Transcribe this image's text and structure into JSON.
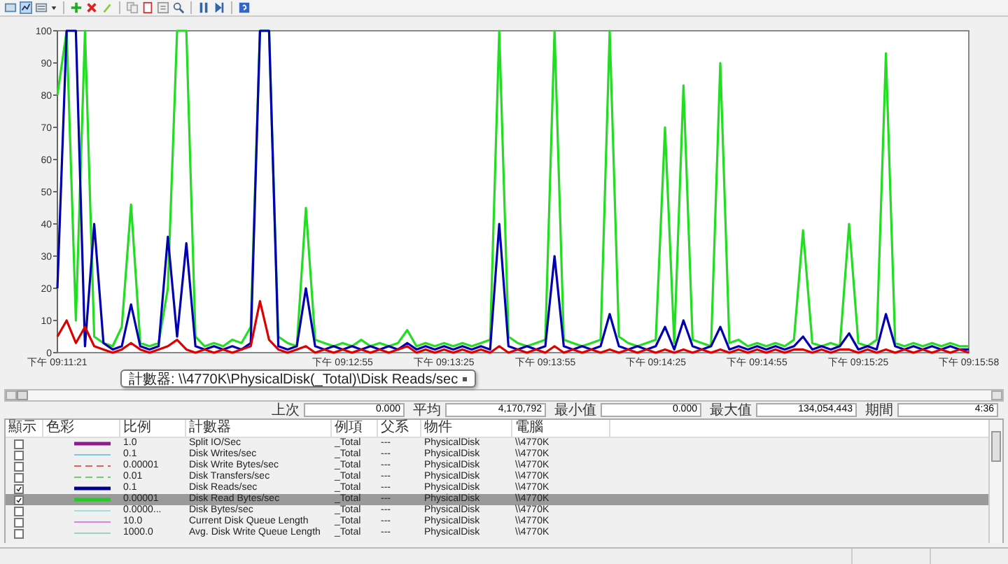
{
  "chart": {
    "tooltip": "計數器: \\\\4770K\\PhysicalDisk(_Total)\\Disk Reads/sec",
    "chart_data": {
      "type": "line",
      "ylim": [
        0,
        100
      ],
      "yticks": [
        0,
        10,
        20,
        30,
        40,
        50,
        60,
        70,
        80,
        90,
        100
      ],
      "categories": [
        "下午 09:11:21",
        null,
        null,
        null,
        null,
        null,
        null,
        null,
        null,
        null,
        null,
        null,
        null,
        null,
        null,
        null,
        null,
        null,
        null,
        null,
        null,
        null,
        null,
        null,
        null,
        null,
        null,
        null,
        null,
        null,
        null,
        "下午 09:12:55",
        null,
        null,
        null,
        null,
        null,
        null,
        null,
        null,
        null,
        null,
        "下午 09:13:25",
        null,
        null,
        null,
        null,
        null,
        null,
        null,
        null,
        null,
        null,
        "下午 09:13:55",
        null,
        null,
        null,
        null,
        null,
        null,
        null,
        null,
        null,
        null,
        null,
        "下午 09:14:25",
        null,
        null,
        null,
        null,
        null,
        null,
        null,
        null,
        null,
        null,
        "下午 09:14:55",
        null,
        null,
        null,
        null,
        null,
        null,
        null,
        null,
        null,
        null,
        "下午 09:15:25",
        null,
        null,
        null,
        null,
        null,
        null,
        null,
        null,
        null,
        null,
        null,
        "下午 09:15:58"
      ],
      "series": [
        {
          "color": "#22dd22",
          "values": [
            80,
            100,
            10,
            100,
            5,
            3,
            2,
            8,
            46,
            3,
            2,
            3,
            20,
            100,
            100,
            5,
            2,
            3,
            2,
            4,
            3,
            8,
            100,
            100,
            5,
            3,
            2,
            45,
            4,
            3,
            2,
            3,
            2,
            4,
            2,
            3,
            2,
            3,
            7,
            2,
            3,
            2,
            3,
            2,
            3,
            2,
            3,
            4,
            100,
            5,
            3,
            2,
            3,
            4,
            100,
            4,
            3,
            2,
            3,
            4,
            100,
            5,
            3,
            2,
            3,
            4,
            70,
            3,
            83,
            4,
            3,
            2,
            90,
            3,
            4,
            2,
            3,
            2,
            3,
            2,
            4,
            38,
            3,
            2,
            3,
            2,
            40,
            3,
            2,
            4,
            93,
            3,
            2,
            3,
            2,
            3,
            2,
            3,
            2,
            2
          ]
        },
        {
          "color": "#0000b0",
          "values": [
            20,
            100,
            100,
            2,
            40,
            3,
            1,
            2,
            15,
            2,
            1,
            2,
            36,
            5,
            34,
            2,
            1,
            2,
            1,
            2,
            1,
            3,
            100,
            100,
            2,
            1,
            2,
            20,
            2,
            1,
            2,
            1,
            2,
            1,
            2,
            1,
            2,
            1,
            3,
            1,
            2,
            1,
            2,
            1,
            2,
            1,
            2,
            1,
            40,
            2,
            1,
            2,
            1,
            2,
            30,
            2,
            1,
            2,
            1,
            2,
            12,
            2,
            1,
            2,
            1,
            2,
            8,
            1,
            10,
            2,
            1,
            2,
            8,
            1,
            2,
            1,
            2,
            1,
            2,
            1,
            2,
            5,
            1,
            2,
            1,
            2,
            6,
            1,
            2,
            1,
            12,
            2,
            1,
            2,
            1,
            2,
            1,
            2,
            1,
            1
          ]
        },
        {
          "color": "#dd0000",
          "values": [
            5,
            10,
            3,
            8,
            2,
            1,
            0,
            1,
            3,
            1,
            0,
            1,
            2,
            4,
            1,
            0,
            1,
            0,
            1,
            0,
            1,
            2,
            16,
            4,
            1,
            0,
            1,
            2,
            0,
            1,
            0,
            1,
            0,
            1,
            0,
            1,
            0,
            1,
            2,
            0,
            1,
            0,
            1,
            0,
            1,
            0,
            1,
            0,
            2,
            0,
            1,
            0,
            1,
            0,
            2,
            0,
            1,
            0,
            1,
            0,
            1,
            0,
            1,
            0,
            1,
            0,
            1,
            0,
            1,
            0,
            1,
            0,
            1,
            0,
            1,
            0,
            1,
            0,
            1,
            0,
            1,
            1,
            0,
            1,
            0,
            1,
            1,
            0,
            1,
            0,
            1,
            0,
            1,
            0,
            1,
            0,
            1,
            0,
            1,
            0
          ]
        }
      ]
    }
  },
  "stats": [
    {
      "label": "上次",
      "value": "0.000"
    },
    {
      "label": "平均",
      "value": "4,170,792"
    },
    {
      "label": "最小值",
      "value": "0.000"
    },
    {
      "label": "最大值",
      "value": "134,054,443"
    },
    {
      "label": "期間",
      "value": "4:36"
    }
  ],
  "table": {
    "columns": [
      "顯示",
      "色彩",
      "比例",
      "計數器",
      "例項",
      "父系",
      "物件",
      "電腦"
    ],
    "rows": [
      {
        "checked": false,
        "selected": false,
        "color": "#8b1a8b",
        "dashed": false,
        "thick": true,
        "scale": "1.0",
        "counter": "Split IO/Sec",
        "instance": "_Total",
        "parent": "---",
        "object": "PhysicalDisk",
        "computer": "\\\\4770K"
      },
      {
        "checked": false,
        "selected": false,
        "color": "#7fc8e0",
        "dashed": false,
        "thick": false,
        "scale": "0.1",
        "counter": "Disk Writes/sec",
        "instance": "_Total",
        "parent": "---",
        "object": "PhysicalDisk",
        "computer": "\\\\4770K"
      },
      {
        "checked": false,
        "selected": false,
        "color": "#e06060",
        "dashed": true,
        "thick": false,
        "scale": "0.00001",
        "counter": "Disk Write Bytes/sec",
        "instance": "_Total",
        "parent": "---",
        "object": "PhysicalDisk",
        "computer": "\\\\4770K"
      },
      {
        "checked": false,
        "selected": false,
        "color": "#70cc70",
        "dashed": true,
        "thick": false,
        "scale": "0.01",
        "counter": "Disk Transfers/sec",
        "instance": "_Total",
        "parent": "---",
        "object": "PhysicalDisk",
        "computer": "\\\\4770K"
      },
      {
        "checked": true,
        "selected": false,
        "color": "#00008b",
        "dashed": false,
        "thick": true,
        "scale": "0.1",
        "counter": "Disk Reads/sec",
        "instance": "_Total",
        "parent": "---",
        "object": "PhysicalDisk",
        "computer": "\\\\4770K"
      },
      {
        "checked": true,
        "selected": true,
        "color": "#22cc22",
        "dashed": false,
        "thick": true,
        "scale": "0.00001",
        "counter": "Disk Read Bytes/sec",
        "instance": "_Total",
        "parent": "---",
        "object": "PhysicalDisk",
        "computer": "\\\\4770K"
      },
      {
        "checked": false,
        "selected": false,
        "color": "#a0e0e0",
        "dashed": false,
        "thick": false,
        "scale": "0.0000...",
        "counter": "Disk Bytes/sec",
        "instance": "_Total",
        "parent": "---",
        "object": "PhysicalDisk",
        "computer": "\\\\4770K"
      },
      {
        "checked": false,
        "selected": false,
        "color": "#e080e0",
        "dashed": false,
        "thick": false,
        "scale": "10.0",
        "counter": "Current Disk Queue Length",
        "instance": "_Total",
        "parent": "---",
        "object": "PhysicalDisk",
        "computer": "\\\\4770K"
      },
      {
        "checked": false,
        "selected": false,
        "color": "#a0d0c0",
        "dashed": false,
        "thick": false,
        "scale": "1000.0",
        "counter": "Avg. Disk Write Queue Length",
        "instance": "_Total",
        "parent": "---",
        "object": "PhysicalDisk",
        "computer": "\\\\4770K"
      }
    ]
  }
}
